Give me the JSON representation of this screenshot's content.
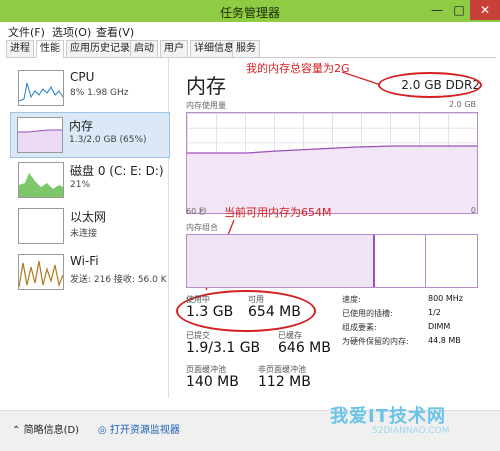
{
  "window": {
    "title": "任务管理器",
    "min": "—",
    "max": "□",
    "close": "✕"
  },
  "menu": [
    "文件(F)",
    "选项(O)",
    "查看(V)"
  ],
  "tabs": [
    "进程",
    "性能",
    "应用历史记录",
    "启动",
    "用户",
    "详细信息",
    "服务"
  ],
  "sidebar": {
    "items": [
      {
        "title": "CPU",
        "sub": "8% 1.98 GHz"
      },
      {
        "title": "内存",
        "sub": "1.3/2.0 GB (65%)"
      },
      {
        "title": "磁盘 0 (C: E: D:)",
        "sub": "21%"
      },
      {
        "title": "以太网",
        "sub": "未连接"
      },
      {
        "title": "Wi-Fi",
        "sub": "发送: 216 接收: 56.0 K"
      }
    ]
  },
  "main": {
    "title": "内存",
    "total": "2.0 GB DDR2",
    "usage_label": "内存使用量",
    "usage_max": "2.0 GB",
    "time_left": "60 秒",
    "time_right": "0",
    "composition_label": "内存组合",
    "stats": {
      "in_use_label": "使用中",
      "in_use": "1.3 GB",
      "available_label": "可用",
      "available": "654 MB",
      "committed_label": "已提交",
      "committed": "1.9/3.1 GB",
      "cached_label": "已缓存",
      "cached": "646 MB",
      "paged_label": "页面缓冲池",
      "paged": "140 MB",
      "nonpaged_label": "非页面缓冲池",
      "nonpaged": "112 MB"
    },
    "right_stats": [
      {
        "label": "速度:",
        "value": "800 MHz"
      },
      {
        "label": "已使用的插槽:",
        "value": "1/2"
      },
      {
        "label": "组成要素:",
        "value": "DIMM"
      },
      {
        "label": "为硬件保留的内存:",
        "value": "44.8 MB"
      }
    ]
  },
  "annotations": {
    "a1": "我的内存总容量为2G",
    "a2": "当前可用内存为654M"
  },
  "footer": {
    "brief": "简略信息(D)",
    "open_monitor": "打开资源监视器"
  },
  "watermark": {
    "main": "我爱IT技术网",
    "sub": "52DIANNAO.COM"
  },
  "colors": {
    "titlebar": "#8fcb43",
    "memory": "#9b4fb8",
    "cpu": "#1a7fc4",
    "disk": "#4aa93a",
    "wifi": "#b07a1a",
    "annotation": "#d42020"
  }
}
